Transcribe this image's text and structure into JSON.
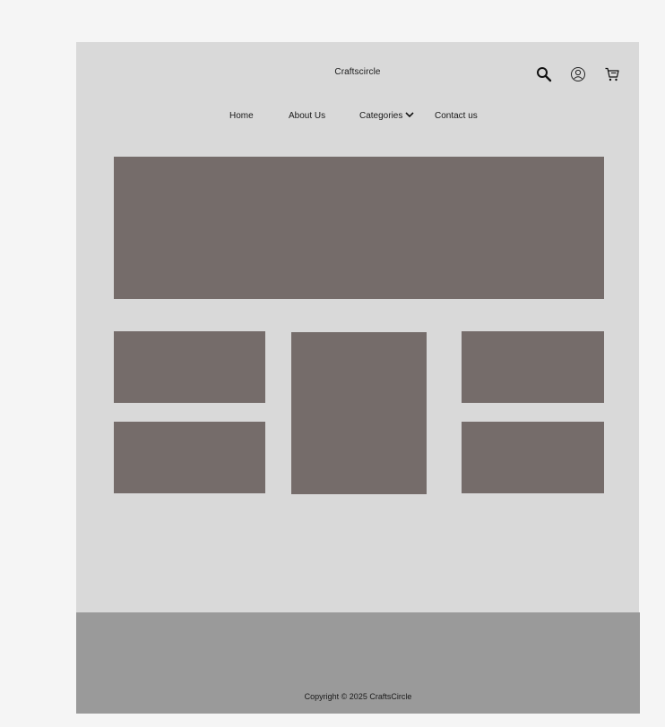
{
  "header": {
    "brand": "Craftscircle",
    "icons": [
      "search-icon",
      "user-icon",
      "cart-icon"
    ]
  },
  "nav": {
    "items": [
      {
        "label": "Home"
      },
      {
        "label": "About Us"
      },
      {
        "label": "Categories"
      },
      {
        "label": "Contact us"
      }
    ]
  },
  "footer": {
    "copyright": "Copyright © 2025 CraftsCircle"
  },
  "colors": {
    "page_bg": "#d9d9d9",
    "placeholder": "#756c6a",
    "footer_bg": "#9a9a9a"
  }
}
